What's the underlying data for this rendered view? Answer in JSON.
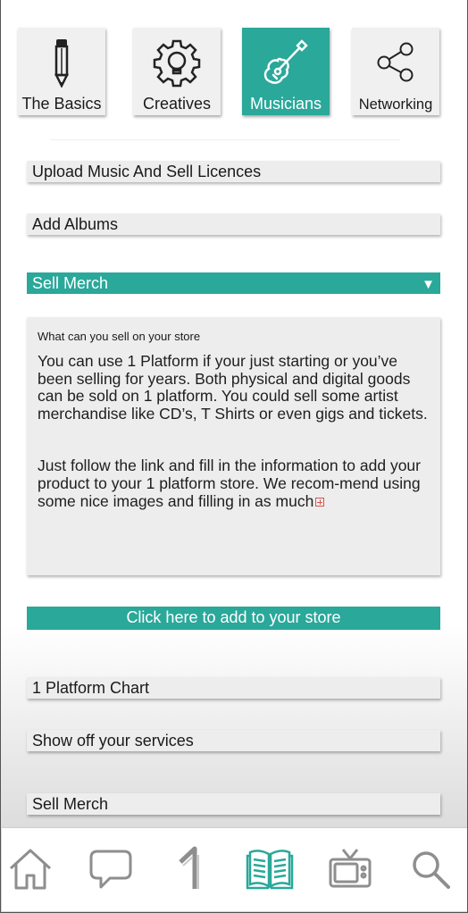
{
  "categories": [
    {
      "label": "The Basics",
      "icon": "pencil-icon",
      "active": false
    },
    {
      "label": "Creatives",
      "icon": "lightbulb-gear-icon",
      "active": false
    },
    {
      "label": "Musicians",
      "icon": "guitar-icon",
      "active": true
    },
    {
      "label": "Networking",
      "icon": "share-icon",
      "active": false
    }
  ],
  "sections": {
    "upload": "Upload Music And Sell Licences",
    "albums": "Add Albums",
    "merch_open": "Sell Merch",
    "merch_arrow": "▼"
  },
  "panel": {
    "heading": "What can you sell on your store",
    "para1": "You can use 1 Platform if your just starting or you’ve been selling for years. Both physical and digital goods can be sold on 1 platform. You could sell some artist merchandise like CD’s, T Shirts or even gigs and tickets.",
    "para2": "Just follow the link and fill in the information to add your product to your 1 platform store. We recom-mend using some nice images and filling in as much"
  },
  "cta_label": "Click here to add to your store",
  "more_sections": {
    "chart": "1 Platform Chart",
    "services": "Show off your services",
    "merch": "Sell Merch"
  },
  "nav": [
    {
      "icon": "home-icon"
    },
    {
      "icon": "chat-bubble-icon"
    },
    {
      "icon": "one-platform-logo-icon"
    },
    {
      "icon": "open-book-icon",
      "active": true
    },
    {
      "icon": "tv-icon"
    },
    {
      "icon": "search-icon"
    }
  ],
  "colors": {
    "accent": "#2aa89a",
    "tile": "#f1f0f0",
    "bar": "#eeeded",
    "icon_gray": "#8e8e8e"
  }
}
